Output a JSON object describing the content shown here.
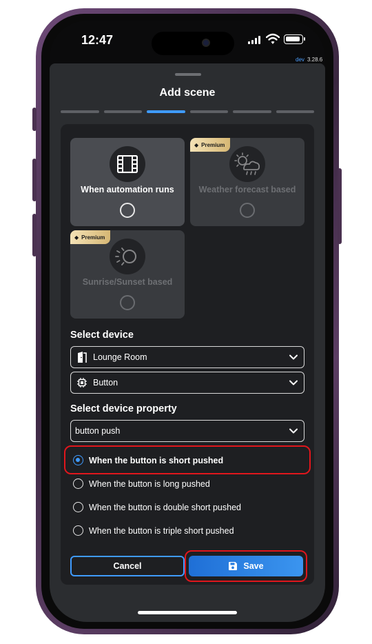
{
  "status_bar": {
    "time": "12:47",
    "dev_label": "dev",
    "version": "3.28.6"
  },
  "sheet": {
    "title": "Add scene",
    "steps_total": 6,
    "steps_active": 2
  },
  "trigger_options": [
    {
      "label": "When automation runs",
      "premium": false,
      "icon": "film-icon",
      "selected": false
    },
    {
      "label": "Weather forecast based",
      "premium": true,
      "icon": "weather-cloud-icon",
      "selected": false
    },
    {
      "label": "Sunrise/Sunset based",
      "premium": true,
      "icon": "sunrise-sunset-icon",
      "selected": false
    }
  ],
  "premium_badge": "Premium",
  "select_device": {
    "heading": "Select device",
    "room": {
      "value": "Lounge Room",
      "icon": "door-icon"
    },
    "device": {
      "value": "Button",
      "icon": "chip-icon"
    }
  },
  "select_property": {
    "heading": "Select device property",
    "value": "button push",
    "options": [
      {
        "label": "When the button is short pushed",
        "checked": true
      },
      {
        "label": "When the button is long pushed",
        "checked": false
      },
      {
        "label": "When the button is double short pushed",
        "checked": false
      },
      {
        "label": "When the button is triple short pushed",
        "checked": false
      }
    ]
  },
  "actions": {
    "cancel_label": "Cancel",
    "save_label": "Save"
  },
  "colors": {
    "accent": "#3f9bff",
    "highlight": "#e0161c",
    "premium_gold": "#d6b774"
  }
}
